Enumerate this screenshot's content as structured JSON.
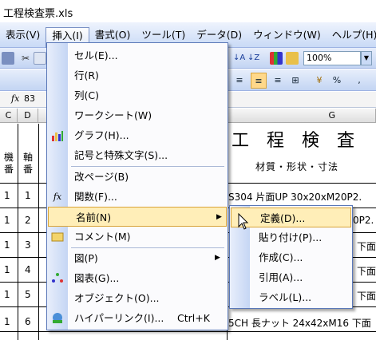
{
  "window": {
    "title": "工程検査票.xls"
  },
  "menubar": {
    "items": [
      {
        "label": "表示(V)",
        "active": false
      },
      {
        "label": "挿入(I)",
        "active": true
      },
      {
        "label": "書式(O)",
        "active": false
      },
      {
        "label": "ツール(T)",
        "active": false
      },
      {
        "label": "データ(D)",
        "active": false
      },
      {
        "label": "ウィンドウ(W)",
        "active": false
      },
      {
        "label": "ヘルプ(H)",
        "active": false
      }
    ]
  },
  "toolbar": {
    "zoom": "100%",
    "percent_btn": "%",
    "comma_btn": ","
  },
  "formula": {
    "fx": "fx",
    "cell_value": "83"
  },
  "grid": {
    "columns": [
      "C",
      "D",
      "G"
    ],
    "header_row": {
      "c": "機番",
      "d": "軸番"
    },
    "rows": [
      "1",
      "1",
      "1",
      "1",
      "1",
      "1"
    ],
    "d_values": [
      "1",
      "2",
      "3",
      "4",
      "5",
      "6"
    ],
    "title": "工程検査",
    "subtitle": "材質・形状・寸法",
    "g_texts": [
      "S304 片面UP 30x20xM20P2.",
      "0P2.",
      "下面",
      "下面",
      "下面",
      "5CH 長ナット 24x42xM16 下面"
    ]
  },
  "insert_menu": {
    "items": [
      {
        "label": "セル(E)...",
        "icon": "",
        "shortcut": "",
        "submenu": false
      },
      {
        "label": "行(R)",
        "icon": "",
        "shortcut": "",
        "submenu": false
      },
      {
        "label": "列(C)",
        "icon": "",
        "shortcut": "",
        "submenu": false
      },
      {
        "label": "ワークシート(W)",
        "icon": "",
        "shortcut": "",
        "submenu": false
      },
      {
        "label": "グラフ(H)...",
        "icon": "chart-icon",
        "shortcut": "",
        "submenu": false
      },
      {
        "label": "記号と特殊文字(S)...",
        "icon": "",
        "shortcut": "",
        "submenu": false
      },
      {
        "label": "改ページ(B)",
        "icon": "",
        "shortcut": "",
        "submenu": false
      },
      {
        "label": "関数(F)...",
        "icon": "function-icon",
        "shortcut": "",
        "submenu": false
      },
      {
        "label": "名前(N)",
        "icon": "",
        "shortcut": "",
        "submenu": true
      },
      {
        "label": "コメント(M)",
        "icon": "comment-icon",
        "shortcut": "",
        "submenu": false
      },
      {
        "label": "図(P)",
        "icon": "",
        "shortcut": "",
        "submenu": true
      },
      {
        "label": "図表(G)...",
        "icon": "diagram-icon",
        "shortcut": "",
        "submenu": false
      },
      {
        "label": "オブジェクト(O)...",
        "icon": "",
        "shortcut": "",
        "submenu": false
      },
      {
        "label": "ハイパーリンク(I)...",
        "icon": "hyperlink-icon",
        "shortcut": "Ctrl+K",
        "submenu": false
      }
    ]
  },
  "name_submenu": {
    "items": [
      {
        "label": "定義(D)..."
      },
      {
        "label": "貼り付け(P)..."
      },
      {
        "label": "作成(C)..."
      },
      {
        "label": "引用(A)..."
      },
      {
        "label": "ラベル(L)..."
      }
    ]
  },
  "colors": {
    "highlight": "#ffeeb8",
    "highlight_border": "#d8a43a",
    "menu_strip": "#c5d6f4"
  }
}
